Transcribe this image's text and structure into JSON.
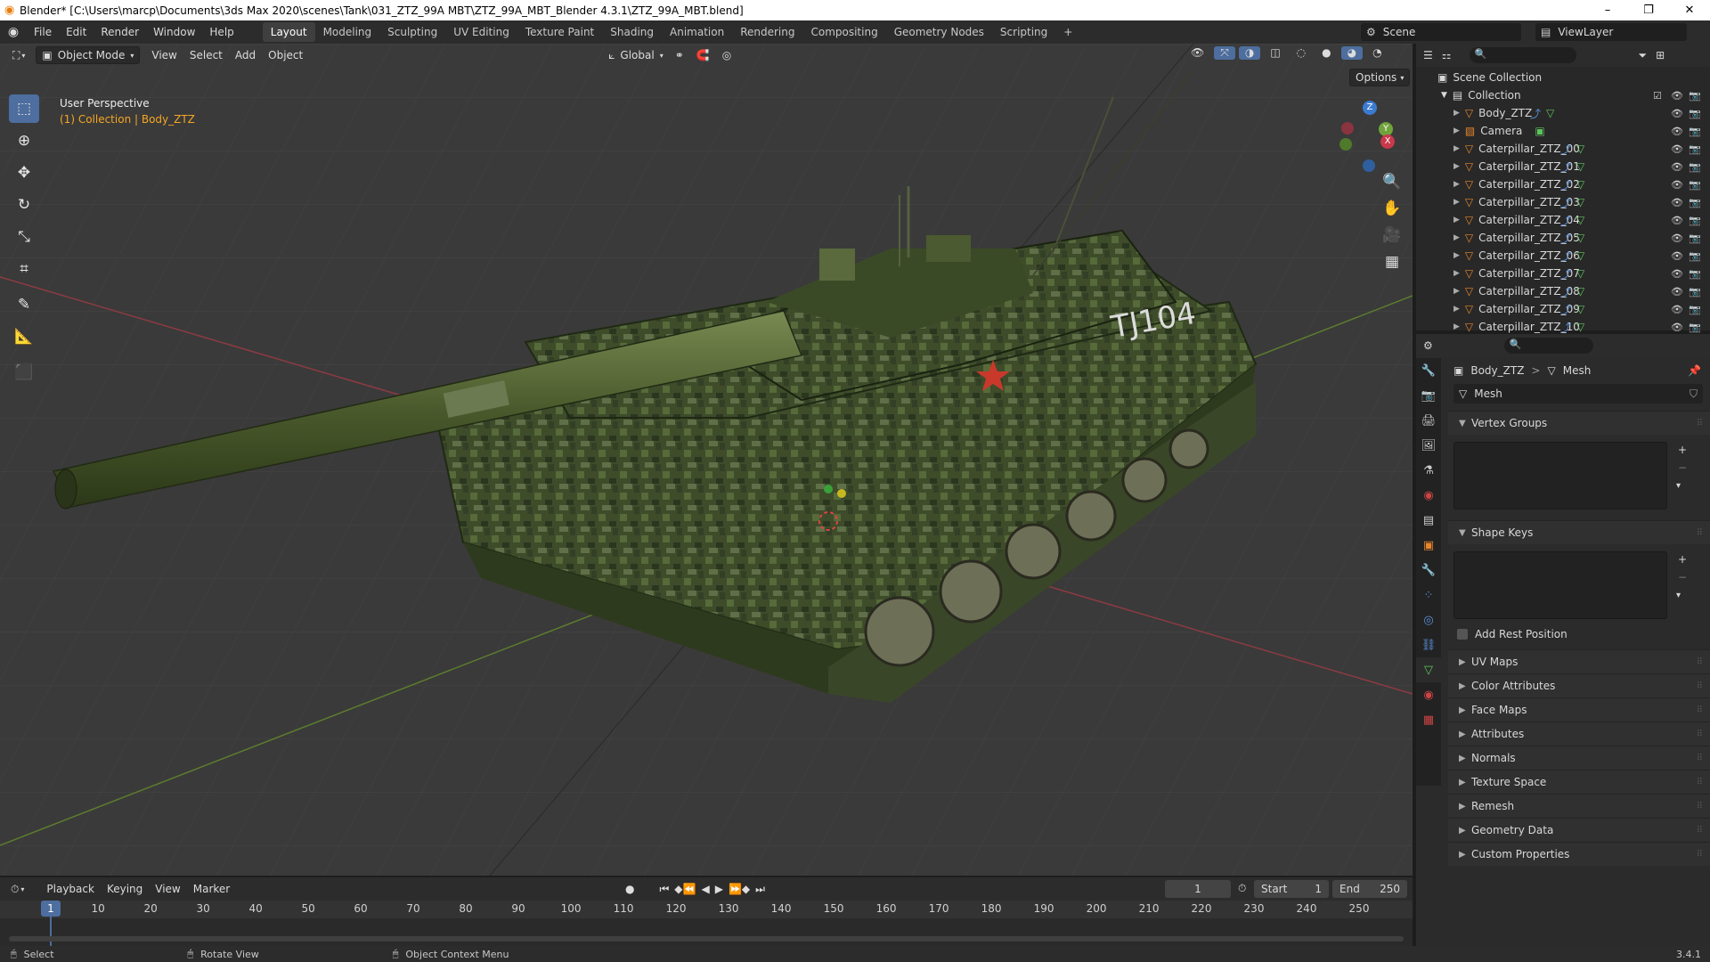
{
  "window": {
    "title": "Blender* [C:\\Users\\marcp\\Documents\\3ds Max 2020\\scenes\\Tank\\031_ZTZ_99A MBT\\ZTZ_99A_MBT_Blender 4.3.1\\ZTZ_99A_MBT.blend]",
    "minimize": "–",
    "maximize": "❐",
    "close": "✕"
  },
  "menu": [
    "File",
    "Edit",
    "Render",
    "Window",
    "Help"
  ],
  "workspaces": [
    "Layout",
    "Modeling",
    "Sculpting",
    "UV Editing",
    "Texture Paint",
    "Shading",
    "Animation",
    "Rendering",
    "Compositing",
    "Geometry Nodes",
    "Scripting"
  ],
  "workspace_add": "+",
  "scene": {
    "name": "Scene",
    "viewlayer": "ViewLayer"
  },
  "viewport": {
    "mode": "Object Mode",
    "menus": [
      "View",
      "Select",
      "Add",
      "Object"
    ],
    "orientation": "Global",
    "options": "Options",
    "perspective": "User Perspective",
    "collection_info": "(1) Collection | Body_ZTZ",
    "tank_turret_text": "TJ104",
    "gizmo": {
      "z": "Z",
      "y": "Y",
      "x": "X"
    }
  },
  "outliner": {
    "root": "Scene Collection",
    "collection": "Collection",
    "items": [
      "Body_ZTZ",
      "Camera",
      "Caterpillar_ZTZ_00",
      "Caterpillar_ZTZ_01",
      "Caterpillar_ZTZ_02",
      "Caterpillar_ZTZ_03",
      "Caterpillar_ZTZ_04",
      "Caterpillar_ZTZ_05",
      "Caterpillar_ZTZ_06",
      "Caterpillar_ZTZ_07",
      "Caterpillar_ZTZ_08",
      "Caterpillar_ZTZ_09",
      "Caterpillar_ZTZ_10"
    ]
  },
  "properties": {
    "breadcrumb_object": "Body_ZTZ",
    "breadcrumb_sep": ">",
    "breadcrumb_data": "Mesh",
    "mesh_name": "Mesh",
    "vertex_groups": "Vertex Groups",
    "shape_keys": "Shape Keys",
    "add_rest_position": "Add Rest Position",
    "sections": [
      "UV Maps",
      "Color Attributes",
      "Face Maps",
      "Attributes",
      "Normals",
      "Texture Space",
      "Remesh",
      "Geometry Data",
      "Custom Properties"
    ]
  },
  "timeline": {
    "menus": [
      "Playback",
      "Keying",
      "View",
      "Marker"
    ],
    "current_frame": "1",
    "start_label": "Start",
    "start": "1",
    "end_label": "End",
    "end": "250",
    "ticks": [
      "1",
      "10",
      "20",
      "30",
      "40",
      "50",
      "60",
      "70",
      "80",
      "90",
      "100",
      "110",
      "120",
      "130",
      "140",
      "150",
      "160",
      "170",
      "180",
      "190",
      "200",
      "210",
      "220",
      "230",
      "240",
      "250"
    ]
  },
  "status": {
    "select": "Select",
    "rotate": "Rotate View",
    "context": "Object Context Menu",
    "version": "3.4.1"
  },
  "colors": {
    "accent": "#4d6e9e",
    "selected_orange": "#f5a623",
    "x_axis": "#c9384b",
    "y_axis": "#71a33b",
    "z_axis": "#3b7bd1"
  }
}
